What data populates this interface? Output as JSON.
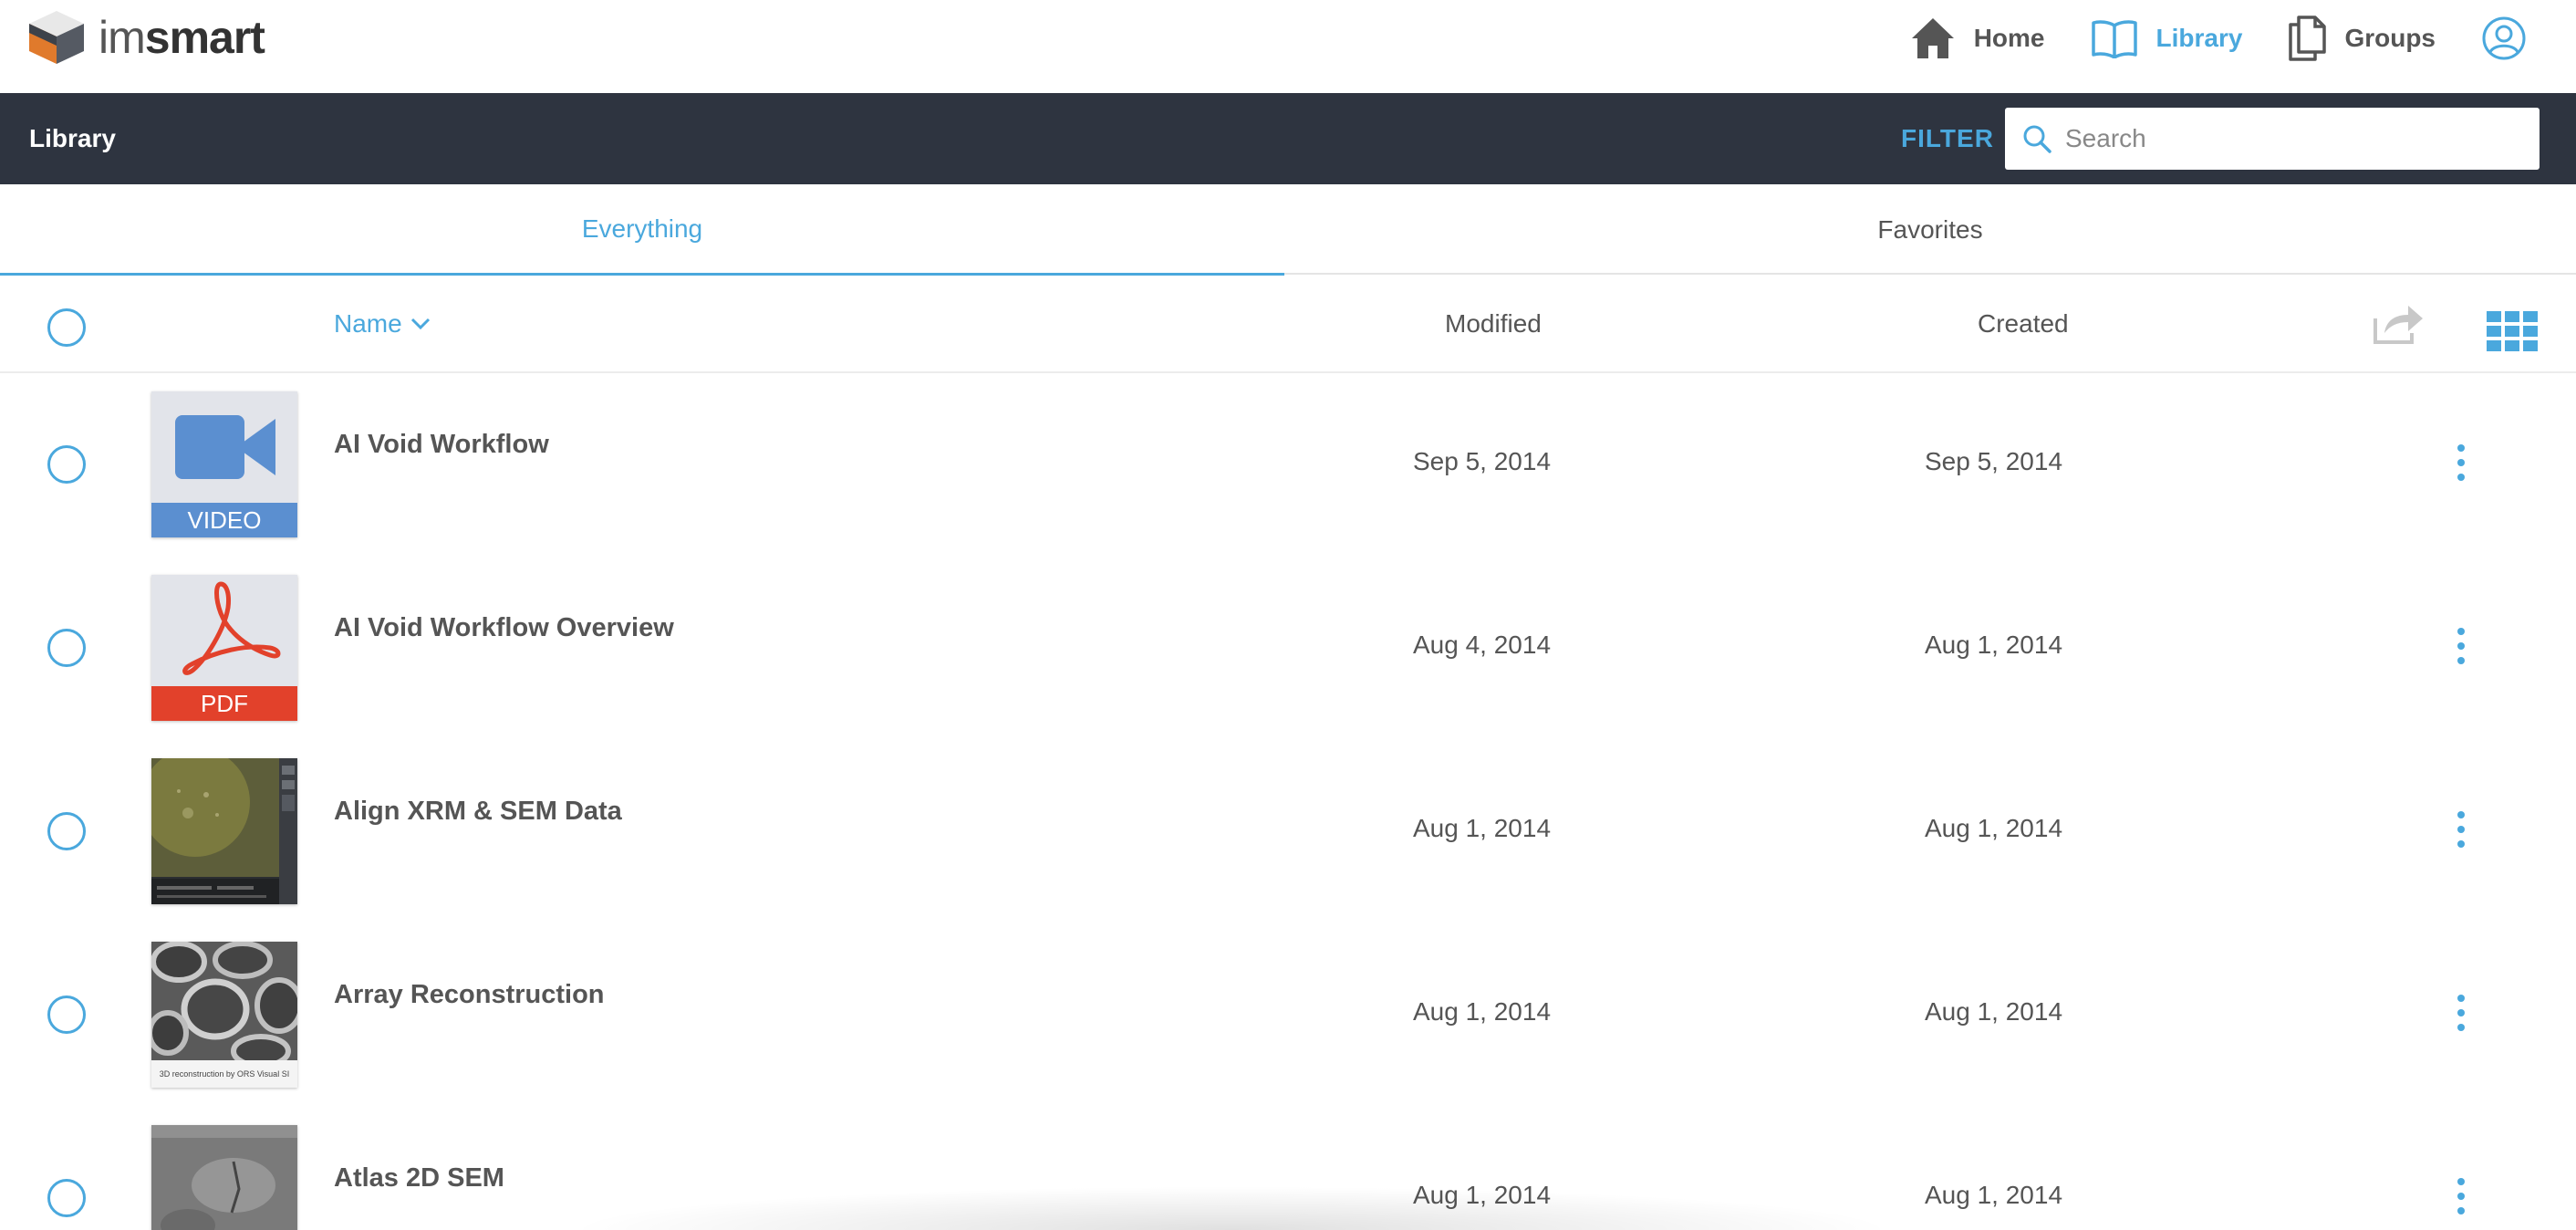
{
  "app": {
    "logo_prefix": "im",
    "logo_suffix": "smart"
  },
  "nav": {
    "home": "Home",
    "library": "Library",
    "groups": "Groups"
  },
  "header": {
    "title": "Library",
    "filter_label": "FILTER",
    "search_placeholder": "Search"
  },
  "tabs": [
    {
      "label": "Everything",
      "active": true
    },
    {
      "label": "Favorites",
      "active": false
    }
  ],
  "columns": {
    "name": "Name",
    "modified": "Modified",
    "created": "Created"
  },
  "rows": [
    {
      "name": "AI Void Workflow",
      "modified": "Sep 5, 2014",
      "created": "Sep 5, 2014",
      "thumb": "video",
      "thumb_label": "VIDEO"
    },
    {
      "name": "AI Void Workflow Overview",
      "modified": "Aug 4, 2014",
      "created": "Aug 1, 2014",
      "thumb": "pdf",
      "thumb_label": "PDF"
    },
    {
      "name": "Align XRM & SEM Data",
      "modified": "Aug 1, 2014",
      "created": "Aug 1, 2014",
      "thumb": "screenshot"
    },
    {
      "name": "Array Reconstruction",
      "modified": "Aug 1, 2014",
      "created": "Aug 1, 2014",
      "thumb": "micrograph",
      "thumb_caption": "3D reconstruction by ORS Visual SI"
    },
    {
      "name": "Atlas 2D SEM",
      "modified": "Aug 1, 2014",
      "created": "Aug 1, 2014",
      "thumb": "sem"
    }
  ],
  "colors": {
    "accent": "#4aa8dd",
    "header_bg": "#2e3440",
    "video": "#5b8fd0",
    "pdf": "#e2412b"
  }
}
